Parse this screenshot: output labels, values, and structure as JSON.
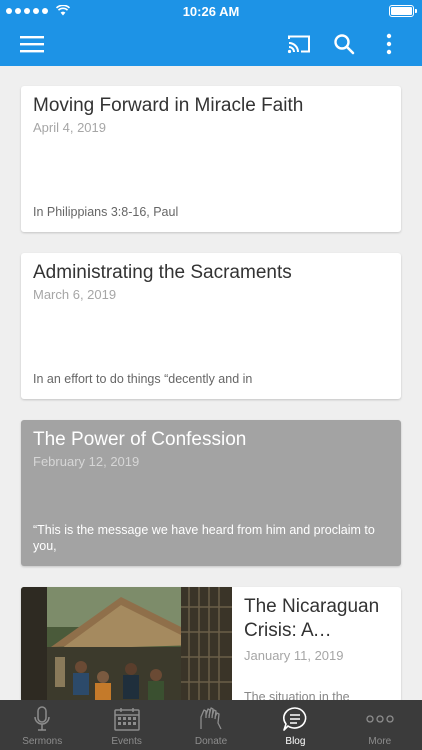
{
  "status_bar": {
    "time": "10:26 AM"
  },
  "nav": {
    "menu_icon": "hamburger-menu-icon",
    "cast_icon": "cast-icon",
    "search_icon": "search-icon",
    "more_icon": "vertical-dots-icon"
  },
  "colors": {
    "primary": "#1d93e6",
    "tab_bar": "#3b3b3b",
    "dark_card": "#a3a3a3"
  },
  "posts": [
    {
      "title": "Moving Forward in Miracle Faith",
      "date": "April 4, 2019",
      "excerpt": "In Philippians 3:8-16, Paul"
    },
    {
      "title": "Administrating the Sacraments",
      "date": "March 6, 2019",
      "excerpt": "In an effort to do things “decently and in"
    },
    {
      "title": "The Power of Confession",
      "date": "February 12, 2019",
      "excerpt": "“This is the message we have heard from him and proclaim to you,"
    },
    {
      "title": "The Nicaraguan Crisis: A Nation…",
      "date": "January 11, 2019",
      "excerpt": "The situation in the"
    }
  ],
  "tabs": [
    {
      "label": "Sermons",
      "icon": "microphone-icon"
    },
    {
      "label": "Events",
      "icon": "calendar-icon"
    },
    {
      "label": "Donate",
      "icon": "hands-icon"
    },
    {
      "label": "Blog",
      "icon": "chat-bubble-icon"
    },
    {
      "label": "More",
      "icon": "horizontal-dots-icon"
    }
  ]
}
